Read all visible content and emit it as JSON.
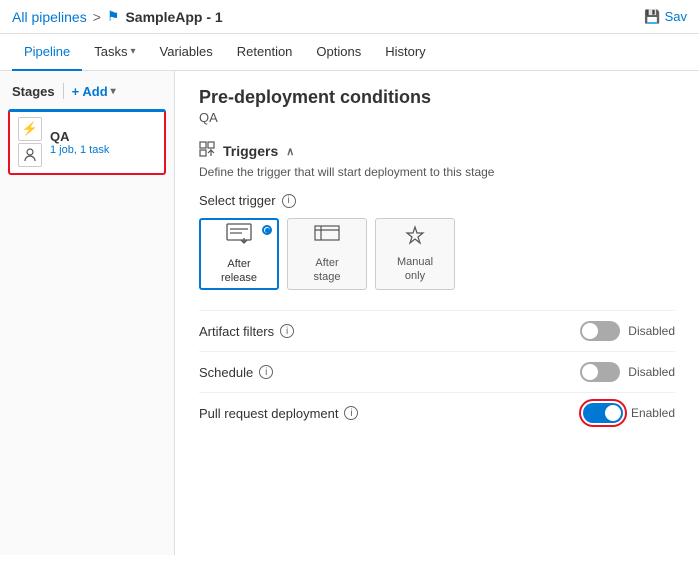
{
  "topbar": {
    "breadcrumb_link": "All pipelines",
    "breadcrumb_separator": ">",
    "pipeline_icon": "⚑",
    "pipeline_title": "SampleApp - 1",
    "save_label": "Sav"
  },
  "nav": {
    "tabs": [
      {
        "id": "pipeline",
        "label": "Pipeline",
        "active": true
      },
      {
        "id": "tasks",
        "label": "Tasks",
        "has_arrow": true
      },
      {
        "id": "variables",
        "label": "Variables"
      },
      {
        "id": "retention",
        "label": "Retention"
      },
      {
        "id": "options",
        "label": "Options"
      },
      {
        "id": "history",
        "label": "History"
      }
    ]
  },
  "sidebar": {
    "header_label": "Stages",
    "divider": "|",
    "add_label": "+ Add",
    "stage": {
      "name": "QA",
      "meta": "1 job, 1 task"
    }
  },
  "content": {
    "page_title": "Pre-deployment conditions",
    "page_subtitle": "QA",
    "section_triggers": {
      "icon": "⚡",
      "label": "Triggers",
      "collapse_icon": "∧",
      "description": "Define the trigger that will start deployment to this stage",
      "select_trigger_label": "Select trigger",
      "options": [
        {
          "id": "after_release",
          "label": "After\nrelease",
          "icon": "🏗",
          "selected": true
        },
        {
          "id": "after_stage",
          "label": "After\nstage",
          "icon": "☰"
        },
        {
          "id": "manual_only",
          "label": "Manual\nonly",
          "icon": "⚡"
        }
      ]
    },
    "rows": [
      {
        "id": "artifact_filters",
        "label": "Artifact filters",
        "toggle": "off",
        "status": "Disabled",
        "bordered": false
      },
      {
        "id": "schedule",
        "label": "Schedule",
        "toggle": "off",
        "status": "Disabled",
        "bordered": false
      },
      {
        "id": "pull_request_deployment",
        "label": "Pull request deployment",
        "toggle": "on",
        "status": "Enabled",
        "bordered": true
      }
    ]
  },
  "icons": {
    "info": "i",
    "lightning": "⚡",
    "building": "🏗",
    "menu": "☰",
    "person": "👤",
    "save": "💾"
  }
}
